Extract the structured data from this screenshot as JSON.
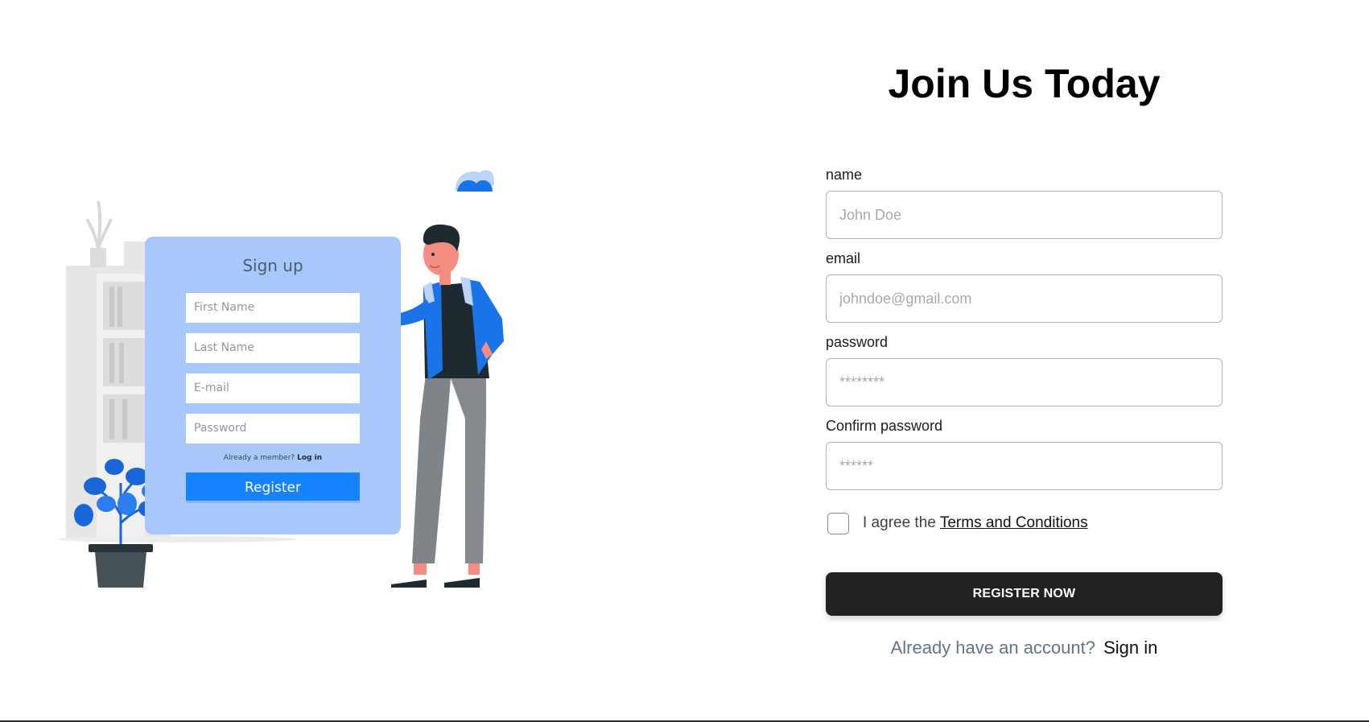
{
  "illustration": {
    "card_title": "Sign up",
    "fields": [
      "First Name",
      "Last Name",
      "E-mail",
      "Password"
    ],
    "member_prompt": "Already a member?",
    "member_link": "Log in",
    "register_label": "Register"
  },
  "form": {
    "title": "Join Us Today",
    "name": {
      "label": "name",
      "placeholder": "John Doe"
    },
    "email": {
      "label": "email",
      "placeholder": "johndoe@gmail.com"
    },
    "password": {
      "label": "password",
      "placeholder": "********"
    },
    "confirm": {
      "label": "Confirm password",
      "placeholder": "******"
    },
    "agree_text": "I agree the",
    "terms_link": "Terms and Conditions",
    "submit_label": "REGISTER NOW",
    "signin_prompt": "Already have an account?",
    "signin_link": "Sign in"
  },
  "colors": {
    "accent": "#1583ff",
    "card_bg": "#a8c8fb",
    "button_dark": "#222222"
  }
}
